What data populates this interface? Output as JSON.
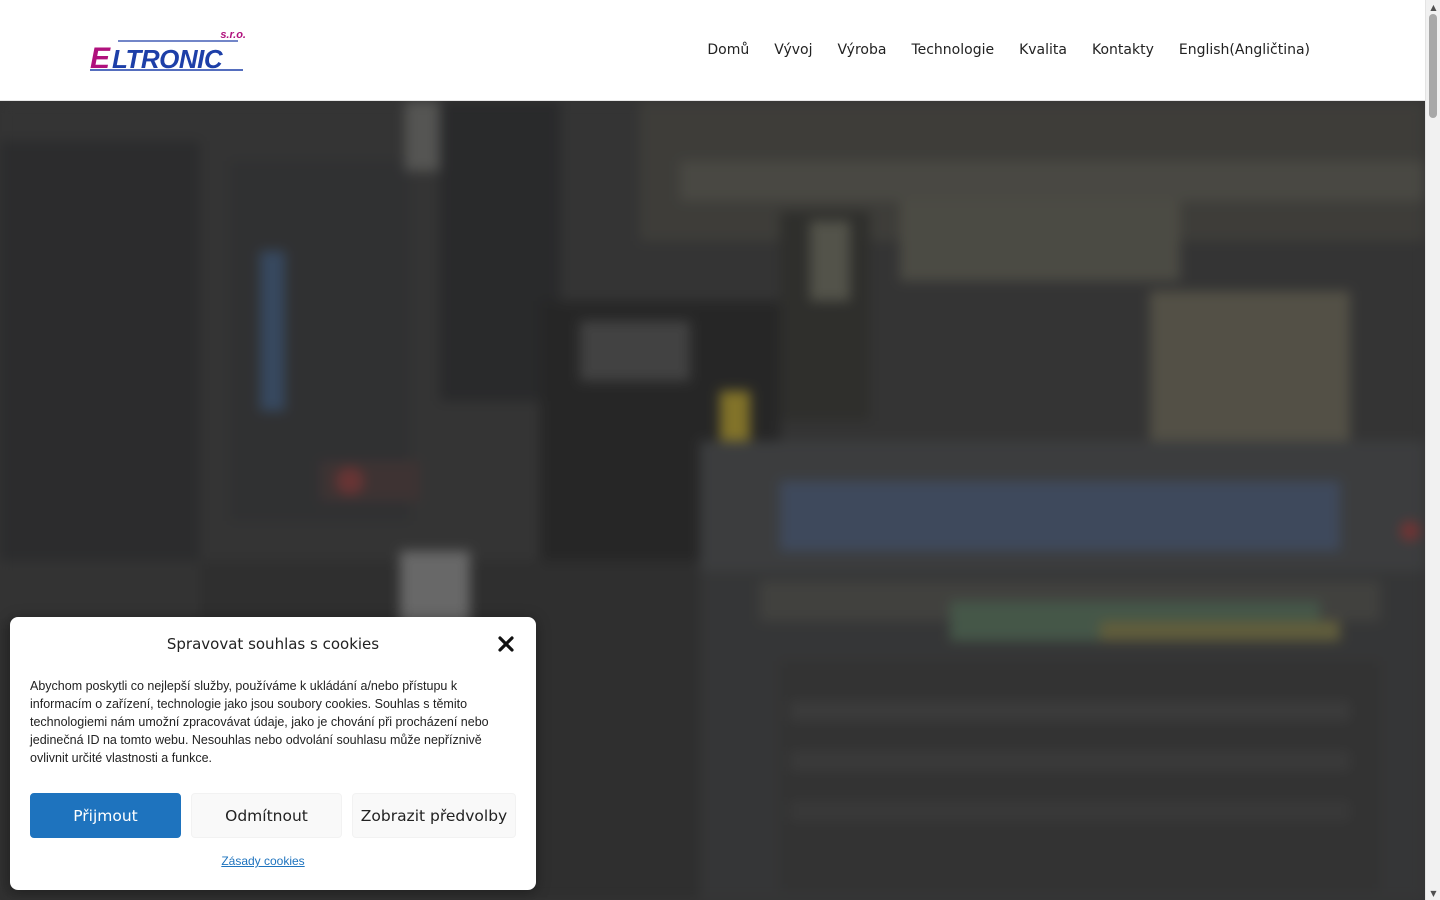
{
  "brand": {
    "logo_text": "ELTRONIC",
    "logo_suffix": "s.r.o.",
    "colors": {
      "magenta": "#b0117d",
      "blue": "#1d3fa8"
    }
  },
  "nav": {
    "items": [
      {
        "label": "Domů"
      },
      {
        "label": "Vývoj"
      },
      {
        "label": "Výroba"
      },
      {
        "label": "Technologie"
      },
      {
        "label": "Kvalita"
      },
      {
        "label": "Kontakty"
      },
      {
        "label": "English(Angličtina)"
      }
    ]
  },
  "hero": {
    "description_icon": "factory-machine-photo"
  },
  "cookie_dialog": {
    "title": "Spravovat souhlas s cookies",
    "close_icon": "close-icon",
    "body": "Abychom poskytli co nejlepší služby, používáme k ukládání a/nebo přístupu k informacím o zařízení, technologie jako jsou soubory cookies. Souhlas s těmito technologiemi nám umožní zpracovávat údaje, jako je chování při procházení nebo jedinečná ID na tomto webu. Nesouhlas nebo odvolání souhlasu může nepříznivě ovlivnit určité vlastnosti a funkce.",
    "accept_label": "Přijmout",
    "deny_label": "Odmítnout",
    "preferences_label": "Zobrazit předvolby",
    "policy_link": "Zásady cookies",
    "accent_color": "#1e73be"
  }
}
